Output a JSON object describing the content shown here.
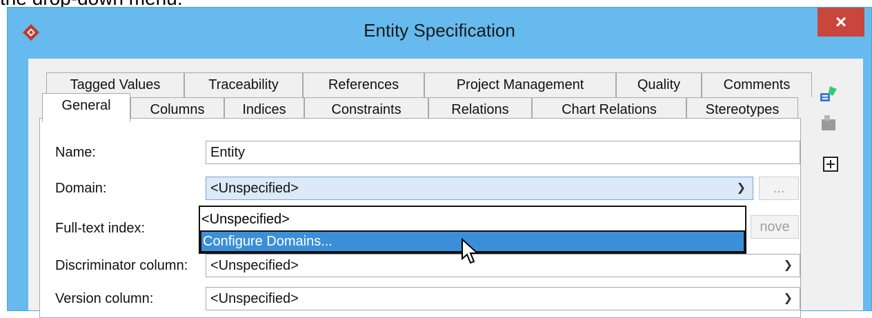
{
  "caption": "the drop-down menu.",
  "window": {
    "title": "Entity Specification",
    "close_label": "×"
  },
  "tabs": {
    "row1": [
      "Tagged Values",
      "Traceability",
      "References",
      "Project Management",
      "Quality",
      "Comments"
    ],
    "row2": [
      "General",
      "Columns",
      "Indices",
      "Constraints",
      "Relations",
      "Chart Relations",
      "Stereotypes"
    ],
    "active": "General"
  },
  "form": {
    "name_label": "Name:",
    "name_value": "Entity",
    "domain_label": "Domain:",
    "domain_value": "<Unspecified>",
    "domain_more_button": "...",
    "fulltext_label": "Full-text index:",
    "fulltext_remove_button": "Remove",
    "fulltext_remove_visible": "nove",
    "discriminator_label": "Discriminator column:",
    "discriminator_value": "<Unspecified>",
    "version_label": "Version column:",
    "version_value": "<Unspecified>"
  },
  "dropdown": {
    "items": [
      "<Unspecified>",
      "Configure Domains..."
    ],
    "highlighted_index": 1
  },
  "icons": {
    "logo": "visual-paradigm-logo-icon",
    "side": [
      "add-tagged-value-icon",
      "tagged-value-disabled-icon",
      "expand-icon"
    ],
    "chevron": "chevron-down-icon"
  },
  "colors": {
    "titlebar": "#66baed",
    "close": "#c9463d",
    "highlight": "#3b8fd9"
  }
}
